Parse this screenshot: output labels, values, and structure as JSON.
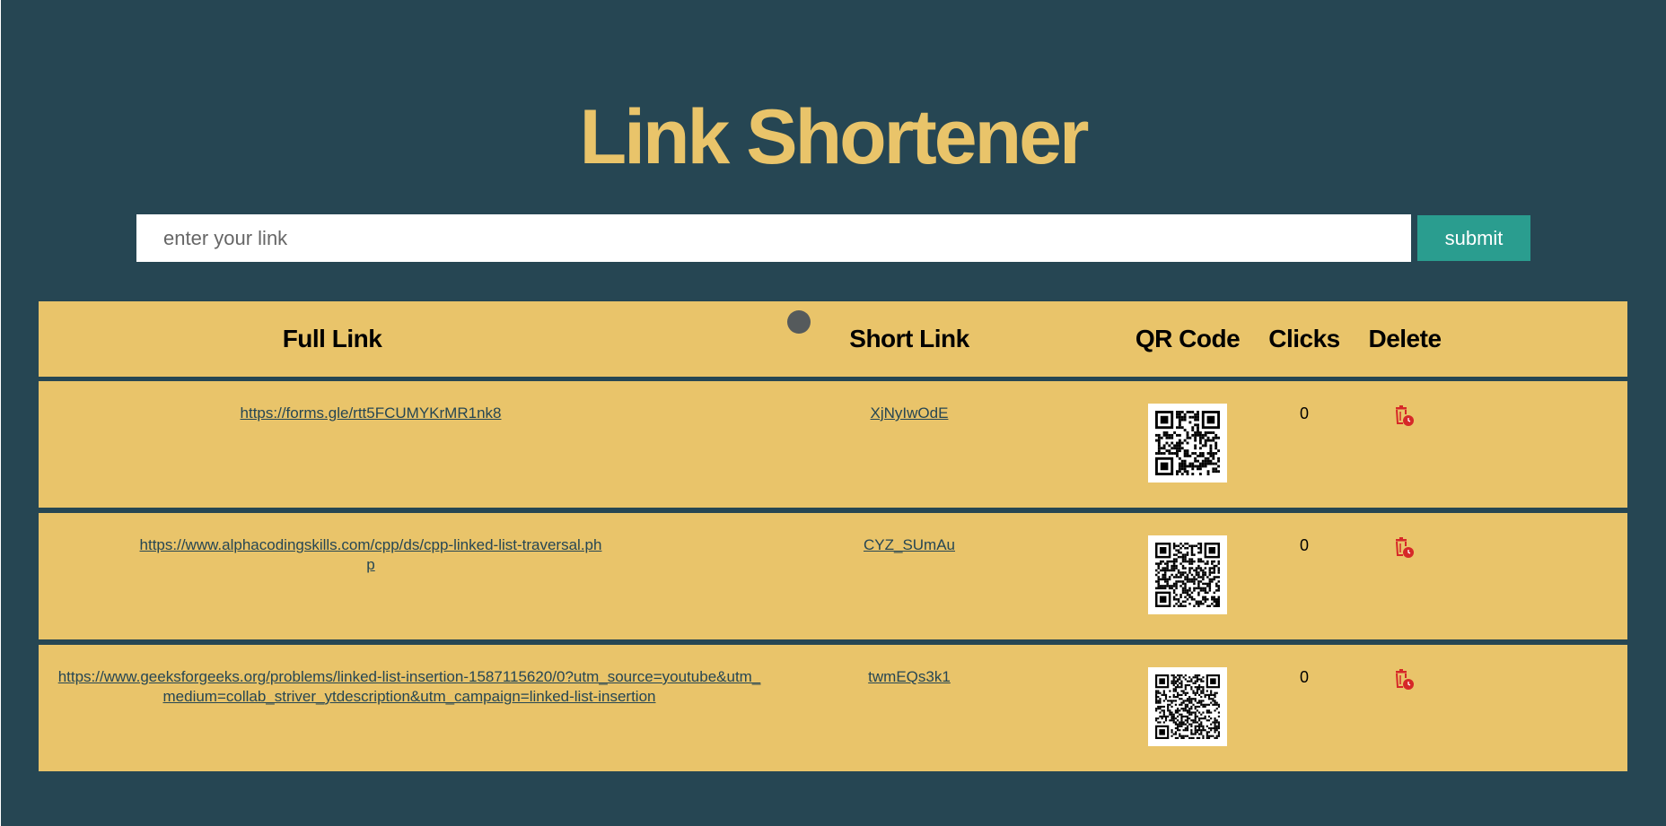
{
  "colors": {
    "background": "#264653",
    "accent": "#e9c46a",
    "button": "#2a9d8f",
    "link": "#264653",
    "delete": "#d62828"
  },
  "header": {
    "title": "Link Shortener"
  },
  "form": {
    "input_value": "",
    "input_placeholder": "enter your link",
    "submit_label": "submit"
  },
  "table": {
    "columns": [
      "Full Link",
      "Short Link",
      "QR Code",
      "Clicks",
      "Delete"
    ],
    "rows": [
      {
        "full_link": "https://forms.gle/rtt5FCUMYKrMR1nk8",
        "short_link": "XjNyIwOdE",
        "clicks": "0",
        "qr_icon": "qr-code-image",
        "delete_icon": "trash-clock-icon"
      },
      {
        "full_link": "https://www.alphacodingskills.com/cpp/ds/cpp-linked-list-traversal.php",
        "short_link": "CYZ_SUmAu",
        "clicks": "0",
        "qr_icon": "qr-code-image",
        "delete_icon": "trash-clock-icon"
      },
      {
        "full_link": "https://www.geeksforgeeks.org/problems/linked-list-insertion-1587115620/0?utm_source=youtube&utm_medium=collab_striver_ytdescription&utm_campaign=linked-list-insertion",
        "short_link": "twmEQs3k1",
        "clicks": "0",
        "qr_icon": "qr-code-image",
        "delete_icon": "trash-clock-icon"
      }
    ]
  }
}
